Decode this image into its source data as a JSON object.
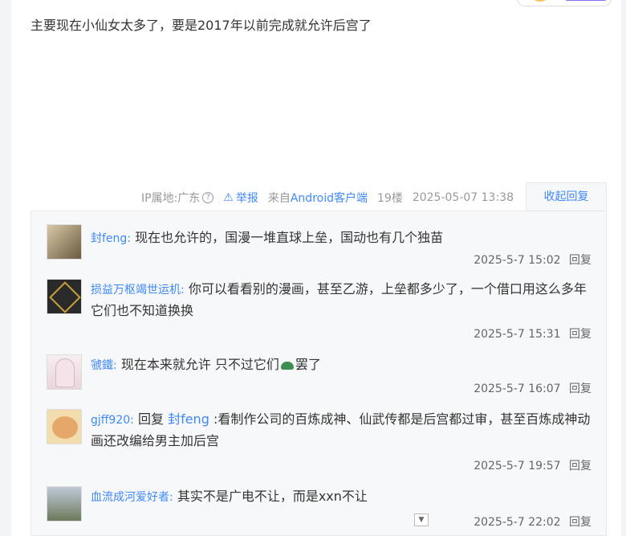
{
  "post": {
    "text": "主要现在小仙女太多了，要是2017年以前完成就允许后宫了"
  },
  "meta": {
    "ip_location": "IP属地:广东",
    "help_icon": "question-circle-icon",
    "report_label": "举报",
    "client_prefix": "来自",
    "client_name": "Android客户端",
    "floor": "19楼",
    "timestamp": "2025-05-07 13:38",
    "collapse_label": "收起回复"
  },
  "replies": [
    {
      "user": "封feng:",
      "text": "现在也允许的，国漫一堆直球上垒，国动也有几个独苗",
      "time": "2025-5-7 15:02",
      "reply_label": "回复"
    },
    {
      "user": "损益万枢竭世运机:",
      "text": "你可以看看别的漫画，甚至乙游，上垒都多少了，一个借口用这么多年它们也不知道换换",
      "time": "2025-5-7 15:31",
      "reply_label": "回复"
    },
    {
      "user": "虢鐵:",
      "text_before": "现在本来就允许 只不过它们",
      "emoji": "turtle-emoji",
      "text_after": "罢了",
      "time": "2025-5-7 16:07",
      "reply_label": "回复"
    },
    {
      "user": "gjff920:",
      "reply_prefix": "回复",
      "reply_to": "封feng",
      "text": ":看制作公司的百炼成神、仙武传都是后宫都过审，甚至百炼成神动画还改编给男主加后宫",
      "time": "2025-5-7 19:57",
      "reply_label": "回复"
    },
    {
      "user": "血流成河爱好者:",
      "text": "其实不是广电不让，而是xxn不让",
      "time": "2025-5-7 22:02",
      "reply_label": "回复"
    }
  ],
  "colors": {
    "link": "#3e89fa",
    "panel_bg": "#f7f8fa",
    "text": "#333333"
  }
}
